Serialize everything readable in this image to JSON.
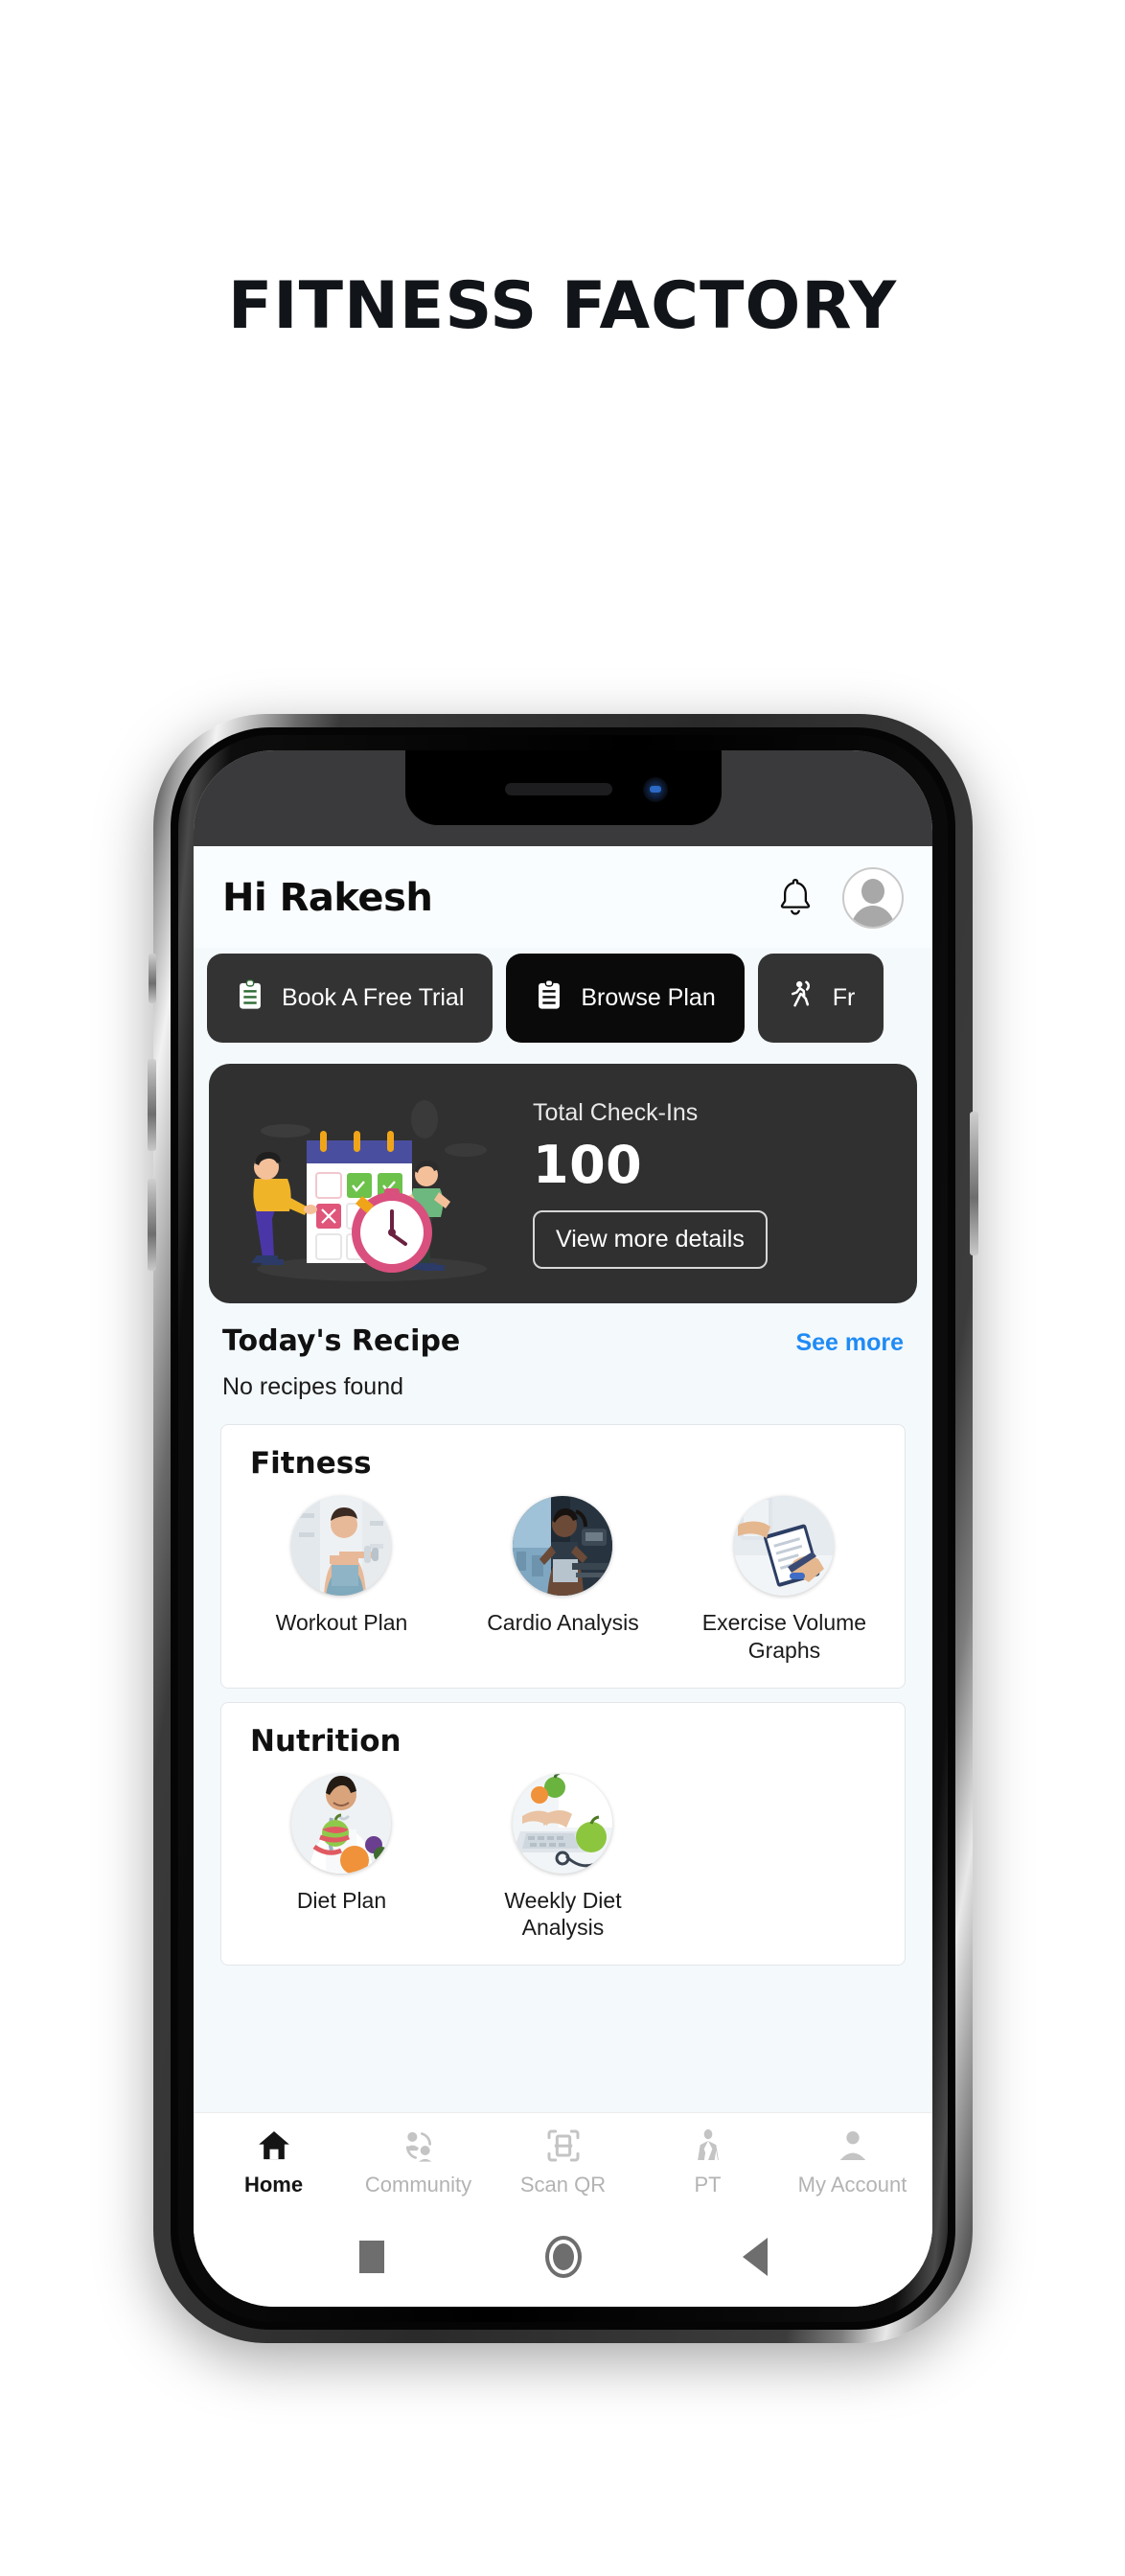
{
  "page": {
    "title": "FITNESS FACTORY"
  },
  "device": {
    "notch": {
      "speaker_icon": "speaker-grille",
      "camera_icon": "front-camera"
    },
    "side_buttons": [
      "mute-switch",
      "volume-up-button",
      "volume-down-button",
      "power-button"
    ]
  },
  "app": {
    "header": {
      "greeting": "Hi Rakesh",
      "bell_icon": "notification-bell-icon",
      "avatar_icon": "user-avatar"
    },
    "quick_actions": [
      {
        "label": "Book A Free Trial",
        "icon": "clipboard-icon",
        "bg": "#333333",
        "icon_color": "#2f6b35"
      },
      {
        "label": "Browse Plan",
        "icon": "clipboard-icon",
        "bg": "#0a0a0a",
        "icon_color": "#ffffff"
      },
      {
        "label": "Fr",
        "icon": "running-person-icon",
        "bg": "#333333",
        "icon_color": "#ffffff"
      }
    ],
    "checkin_card": {
      "label": "Total Check-Ins",
      "value": "100",
      "button_label": "View more details",
      "illustration": "calendar-check-in-illustration",
      "bg": "#303030"
    },
    "recipe": {
      "title": "Today's Recipe",
      "link_label": "See more",
      "link_color": "#1f8bf5",
      "empty_text": "No recipes found"
    },
    "panels": [
      {
        "title": "Fitness",
        "tiles": [
          {
            "label": "Workout Plan",
            "image": "woman-dumbbell-photo"
          },
          {
            "label": "Cardio Analysis",
            "image": "woman-treadmill-photo"
          },
          {
            "label": "Exercise Volume Graphs",
            "image": "hands-clipboard-photo"
          }
        ]
      },
      {
        "title": "Nutrition",
        "tiles": [
          {
            "label": "Diet Plan",
            "image": "dietitian-fruit-photo"
          },
          {
            "label": "Weekly Diet Analysis",
            "image": "laptop-apple-photo"
          }
        ]
      }
    ],
    "tabbar": [
      {
        "label": "Home",
        "icon": "home-icon",
        "active": true
      },
      {
        "label": "Community",
        "icon": "community-icon",
        "active": false
      },
      {
        "label": "Scan QR",
        "icon": "scan-qr-icon",
        "active": false
      },
      {
        "label": "PT",
        "icon": "personal-trainer-icon",
        "active": false
      },
      {
        "label": "My Account",
        "icon": "person-icon",
        "active": false
      }
    ]
  },
  "system_nav": {
    "recents_icon": "square-recents-icon",
    "home_icon": "circle-home-icon",
    "back_icon": "triangle-back-icon"
  }
}
